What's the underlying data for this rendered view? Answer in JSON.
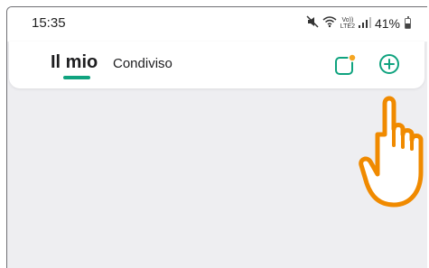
{
  "status_bar": {
    "time": "15:35",
    "signal_label": "Vo))\nLTE2",
    "battery_percent": "41%",
    "battery_level": 0.41,
    "icons": [
      "mute-icon",
      "wifi-icon",
      "volte-icon",
      "signal-icon",
      "battery-icon"
    ]
  },
  "header": {
    "tabs": [
      {
        "label": "Il mio",
        "selected": true
      },
      {
        "label": "Condiviso",
        "selected": false
      }
    ],
    "actions": [
      {
        "icon": "notification-square-icon",
        "badge": true
      },
      {
        "icon": "add-circle-icon"
      }
    ]
  },
  "colors": {
    "accent": "#10a37f",
    "badge": "#f5a623",
    "background": "#eeeef1",
    "hand_outline": "#f08a00"
  }
}
